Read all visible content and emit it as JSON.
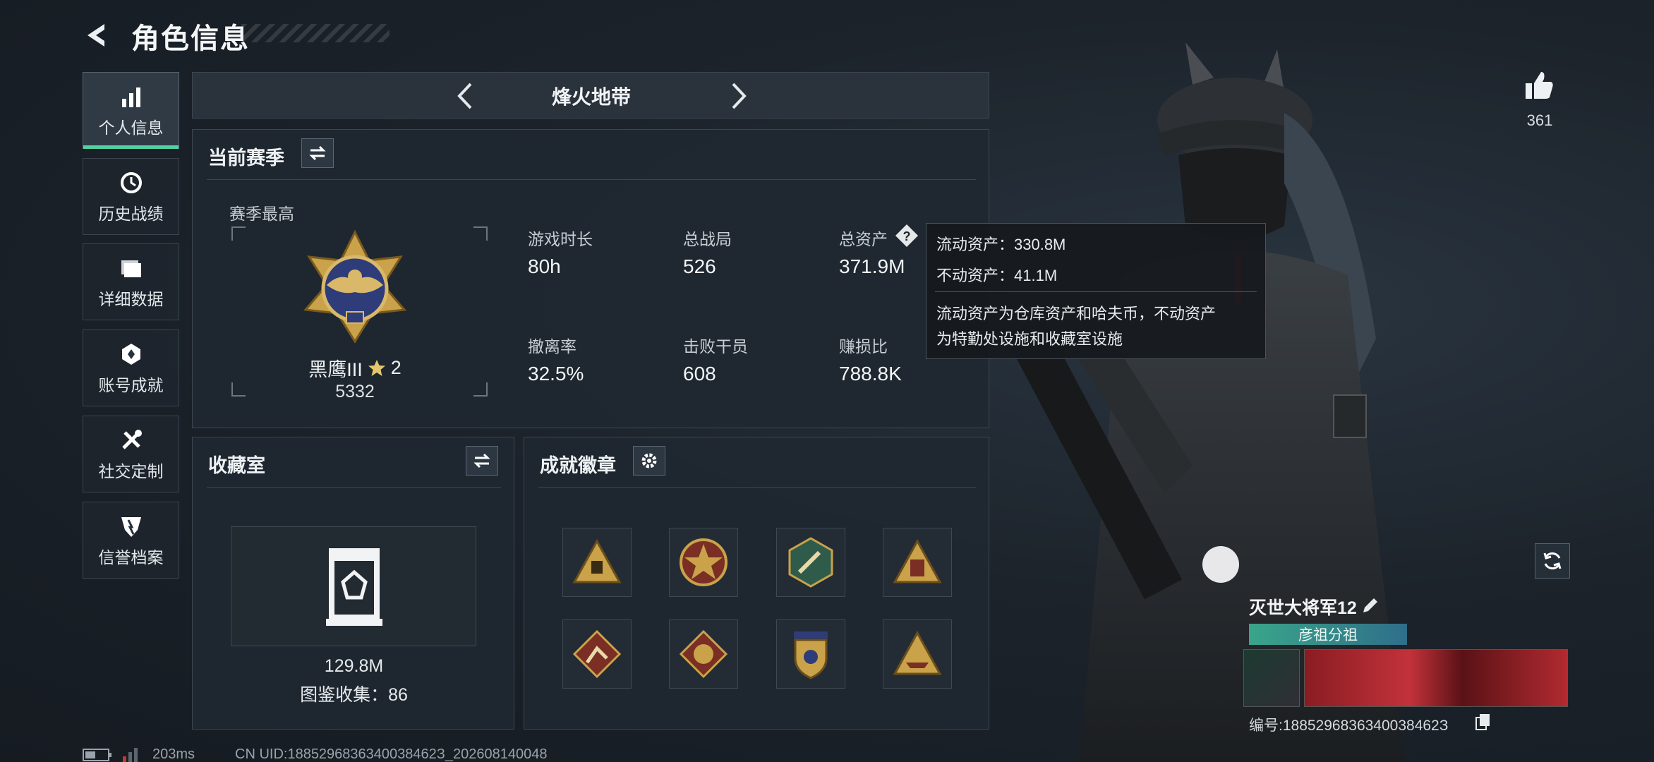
{
  "header": {
    "title": "角色信息"
  },
  "sidebar": {
    "items": [
      {
        "label": "个人信息",
        "icon": "bar-chart-icon",
        "active": true
      },
      {
        "label": "历史战绩",
        "icon": "history-icon"
      },
      {
        "label": "详细数据",
        "icon": "folder-icon"
      },
      {
        "label": "账号成就",
        "icon": "achievement-icon"
      },
      {
        "label": "社交定制",
        "icon": "tools-icon"
      },
      {
        "label": "信誉档案",
        "icon": "credit-icon"
      }
    ]
  },
  "mode": {
    "title": "烽火地带"
  },
  "season": {
    "title": "当前赛季",
    "best_label": "赛季最高",
    "rank_name": "黑鹰III",
    "rank_stars": "2",
    "rank_score": "5332",
    "stats": [
      {
        "label": "游戏时长",
        "value": "80h"
      },
      {
        "label": "总战局",
        "value": "526"
      },
      {
        "label": "总资产",
        "value": "371.9M"
      },
      {
        "label": "撤离率",
        "value": "32.5%"
      },
      {
        "label": "击败干员",
        "value": "608"
      },
      {
        "label": "赚损比",
        "value": "788.8K"
      }
    ]
  },
  "tooltip": {
    "line1": "流动资产：330.8M",
    "line2": "不动资产：41.1M",
    "desc1": "流动资产为仓库资产和哈夫币，不动资产",
    "desc2": "为特勤处设施和收藏室设施"
  },
  "collection": {
    "title": "收藏室",
    "value": "129.8M",
    "catalog": "图鉴收集：86"
  },
  "achievements": {
    "title": "成就徽章",
    "badges": [
      "triangle-badge-icon",
      "star-badge-icon",
      "hexagon-badge-icon",
      "triangle-badge-icon",
      "climber-badge-icon",
      "dragon-badge-icon",
      "shield-badge-icon",
      "boat-badge-icon"
    ]
  },
  "likes": {
    "count": "361"
  },
  "player": {
    "name": "灭世大将军12",
    "tag": "彦祖分祖",
    "id": "编号:1885296836340038462З"
  },
  "footer": {
    "ping": "203ms",
    "uid": "CN UID:1885296836340038462З_202608140048"
  },
  "colors": {
    "accent": "#4fd3a1",
    "gold": "#c9a24a"
  }
}
